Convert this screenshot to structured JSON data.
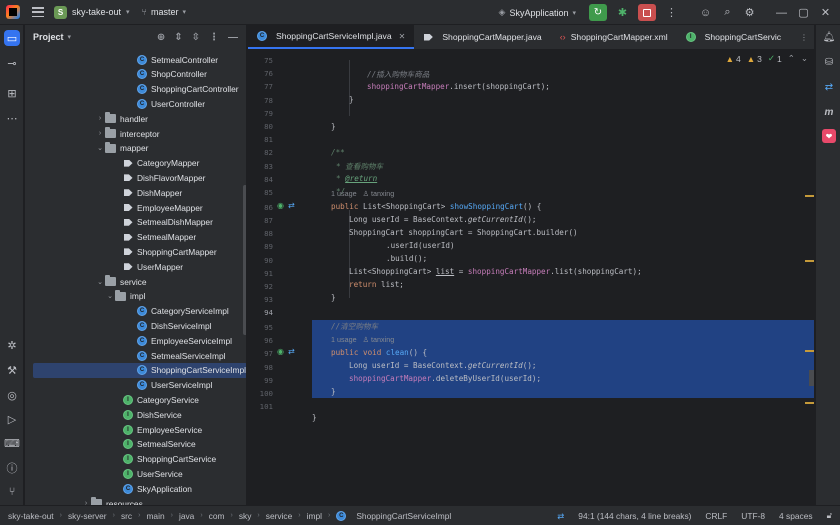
{
  "titlebar": {
    "project_letter": "S",
    "project_name": "sky-take-out",
    "branch": "master",
    "run_config": "SkyApplication"
  },
  "project_panel": {
    "title": "Project",
    "items": [
      {
        "label": "SetmealController",
        "kind": "class"
      },
      {
        "label": "ShopController",
        "kind": "class"
      },
      {
        "label": "ShoppingCartController",
        "kind": "class"
      },
      {
        "label": "UserController",
        "kind": "class"
      },
      {
        "label": "handler",
        "kind": "folder"
      },
      {
        "label": "interceptor",
        "kind": "folder"
      },
      {
        "label": "mapper",
        "kind": "folder"
      },
      {
        "label": "CategoryMapper",
        "kind": "mapper"
      },
      {
        "label": "DishFlavorMapper",
        "kind": "mapper"
      },
      {
        "label": "DishMapper",
        "kind": "mapper"
      },
      {
        "label": "EmployeeMapper",
        "kind": "mapper"
      },
      {
        "label": "SetmealDishMapper",
        "kind": "mapper"
      },
      {
        "label": "SetmealMapper",
        "kind": "mapper"
      },
      {
        "label": "ShoppingCartMapper",
        "kind": "mapper"
      },
      {
        "label": "UserMapper",
        "kind": "mapper"
      },
      {
        "label": "service",
        "kind": "folder"
      },
      {
        "label": "impl",
        "kind": "folder"
      },
      {
        "label": "CategoryServiceImpl",
        "kind": "class"
      },
      {
        "label": "DishServiceImpl",
        "kind": "class"
      },
      {
        "label": "EmployeeServiceImpl",
        "kind": "class"
      },
      {
        "label": "SetmealServiceImpl",
        "kind": "class"
      },
      {
        "label": "ShoppingCartServiceImpl",
        "kind": "class"
      },
      {
        "label": "UserServiceImpl",
        "kind": "class"
      },
      {
        "label": "CategoryService",
        "kind": "interface"
      },
      {
        "label": "DishService",
        "kind": "interface"
      },
      {
        "label": "EmployeeService",
        "kind": "interface"
      },
      {
        "label": "SetmealService",
        "kind": "interface"
      },
      {
        "label": "ShoppingCartService",
        "kind": "interface"
      },
      {
        "label": "UserService",
        "kind": "interface"
      },
      {
        "label": "SkyApplication",
        "kind": "class"
      },
      {
        "label": "resources",
        "kind": "folder"
      }
    ]
  },
  "tabs": [
    {
      "label": "ShoppingCartServiceImpl.java",
      "active": true
    },
    {
      "label": "ShoppingCartMapper.java",
      "active": false
    },
    {
      "label": "ShoppingCartMapper.xml",
      "active": false
    },
    {
      "label": "ShoppingCartServic",
      "active": false
    }
  ],
  "inspections": {
    "warnings": "4",
    "weak_warnings": "3",
    "ok": "1"
  },
  "editor": {
    "line_numbers": [
      "75",
      "76",
      "77",
      "78",
      "79",
      "80",
      "81",
      "82",
      "83",
      "84",
      "85",
      "86",
      "87",
      "88",
      "89",
      "90",
      "91",
      "92",
      "93",
      "94",
      "95",
      "96",
      "97",
      "98",
      "99",
      "100",
      "101"
    ],
    "current_line": "94",
    "lines": {
      "l76": "//插入购物车商品",
      "l77_field": "shoppingCartMapper",
      "l77_rest": ".insert(shoppingCart);",
      "l78": "}",
      "l80": "}",
      "l82": "/**",
      "l83": "* 查看购物车",
      "l84_star": "*",
      "l84_tag": "@return",
      "l85": "*/",
      "hint1_usage": "1 usage",
      "hint1_author": "tanxing",
      "l86_kw": "public",
      "l86_type": "List<ShoppingCart>",
      "l86_fn": "showShoppingCart",
      "l86_rest": "() {",
      "l87_a": "Long userId = BaseContext.",
      "l87_call": "getCurrentId",
      "l87_b": "();",
      "l88": "ShoppingCart shoppingCart = ShoppingCart.builder()",
      "l89": ".userId(userId)",
      "l90": ".build();",
      "l91_a": "List<ShoppingCart>",
      "l91_var": "list",
      "l91_b": "=",
      "l91_field": "shoppingCartMapper",
      "l91_c": ".list(shoppingCart);",
      "l92_kw": "return",
      "l92_rest": "list;",
      "l93": "}",
      "l95": "//清空购物车",
      "hint2_usage": "1 usage",
      "hint2_author": "tanxing",
      "l96_kw1": "public",
      "l96_kw2": "void",
      "l96_fn": "clean",
      "l96_rest": "() {",
      "l97_a": "Long userId = BaseContext.",
      "l97_call": "getCurrentId",
      "l97_b": "();",
      "l98_field": "shoppingCartMapper",
      "l98_rest": ".deleteByUserId(userId);",
      "l99": "}",
      "l101": "}"
    }
  },
  "statusbar": {
    "breadcrumbs": [
      "sky-take-out",
      "sky-server",
      "src",
      "main",
      "java",
      "com",
      "sky",
      "service",
      "impl",
      "ShoppingCartServiceImpl"
    ],
    "position": "94:1 (144 chars, 4 line breaks)",
    "line_sep": "CRLF",
    "encoding": "UTF-8",
    "indent": "4 spaces"
  }
}
